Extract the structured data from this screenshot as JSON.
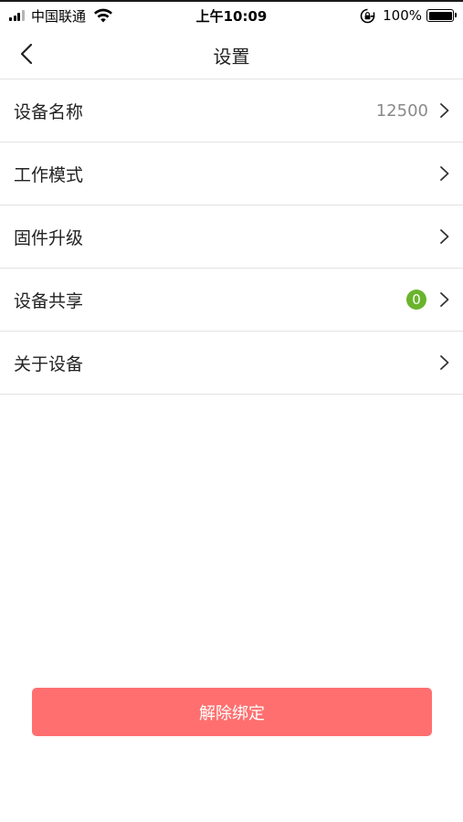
{
  "status_bar": {
    "carrier": "中国联通",
    "time": "上午10:09",
    "battery": "100%"
  },
  "nav": {
    "title": "设置",
    "back_icon": "chevron-left-icon"
  },
  "settings": {
    "items": [
      {
        "label": "设备名称",
        "value": "12500"
      },
      {
        "label": "工作模式"
      },
      {
        "label": "固件升级"
      },
      {
        "label": "设备共享",
        "badge": "0"
      },
      {
        "label": "关于设备"
      }
    ]
  },
  "unbind_label": "解除绑定",
  "colors": {
    "unbind_button": "#ff6f6f",
    "badge": "#6ab42d",
    "divider": "#e2e2e2"
  }
}
